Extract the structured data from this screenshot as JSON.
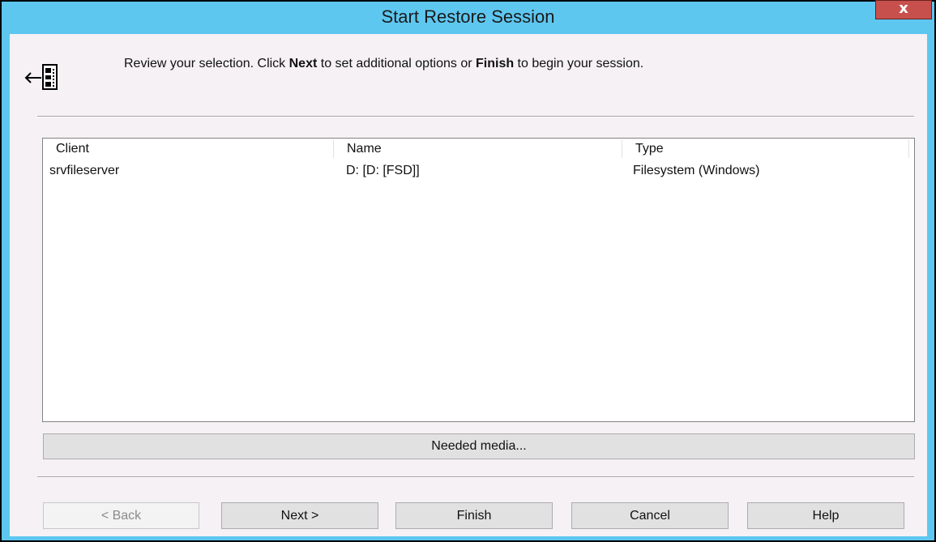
{
  "window": {
    "title": "Start Restore Session",
    "close_glyph": "x"
  },
  "header": {
    "icon": "wizard-back-icon",
    "text_part1": "Review your selection. Click ",
    "text_next": "Next",
    "text_part2": " to set additional options or ",
    "text_finish": "Finish",
    "text_part3": " to begin your session."
  },
  "list": {
    "columns": [
      "Client",
      "Name",
      "Type"
    ],
    "rows": [
      [
        "srvfileserver",
        "D: [D: [FSD]]",
        "Filesystem (Windows)"
      ]
    ]
  },
  "needed_media_label": "Needed media...",
  "buttons": {
    "back": "< Back",
    "next": "Next >",
    "finish": "Finish",
    "cancel": "Cancel",
    "help": "Help"
  },
  "colors": {
    "titlebar": "#5ec7f0",
    "dialog_bg": "#f5f1f5",
    "close_button": "#c7504d"
  }
}
